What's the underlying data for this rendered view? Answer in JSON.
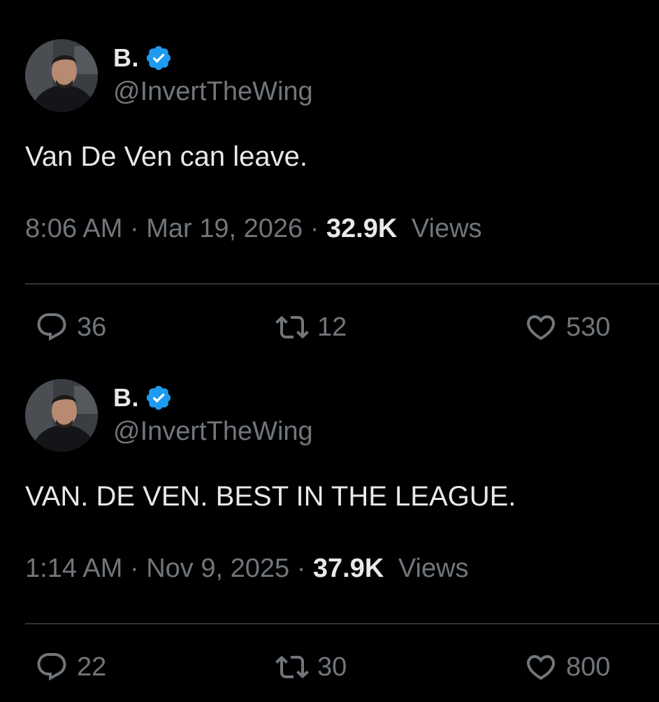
{
  "tweets": [
    {
      "author": {
        "display_name": "B.",
        "handle": "@InvertTheWing",
        "verified": true
      },
      "text": "Van De Ven can leave.",
      "time": "8:06 AM",
      "date": "Mar 19, 2026",
      "separator": "·",
      "views_count": "32.9K",
      "views_label": "Views",
      "replies": "36",
      "retweets": "12",
      "likes": "530"
    },
    {
      "author": {
        "display_name": "B.",
        "handle": "@InvertTheWing",
        "verified": true
      },
      "text": "VAN. DE VEN. BEST IN THE LEAGUE.",
      "time": "1:14 AM",
      "date": "Nov 9, 2025",
      "separator": "·",
      "views_count": "37.9K",
      "views_label": "Views",
      "replies": "22",
      "retweets": "30",
      "likes": "800"
    }
  ],
  "colors": {
    "background": "#000000",
    "primary_text": "#e7e9ea",
    "secondary_text": "#71767b",
    "divider": "#2f3336",
    "verified_badge": "#1d9bf0"
  },
  "icons": {
    "reply": "speech-bubble-icon",
    "retweet": "retweet-arrows-icon",
    "like": "heart-icon",
    "verified": "verified-badge-icon"
  }
}
